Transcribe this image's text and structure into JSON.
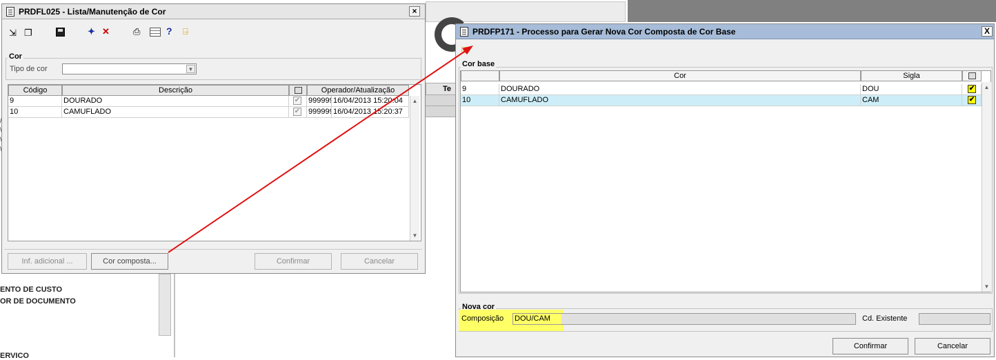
{
  "background": {
    "right_column_header": "Te",
    "left_list": [
      "ENTO DE CUSTO",
      "OR DE DOCUMENTO",
      "ERVICO"
    ]
  },
  "win1": {
    "title": "PRDFL025 - Lista/Manutenção de Cor",
    "close_glyph": "×",
    "group_label": "Cor",
    "tipo_label": "Tipo de cor",
    "tipo_value": "",
    "columns": [
      "Código",
      "Descrição",
      "",
      "Operador/Atualização"
    ],
    "rows": [
      {
        "codigo": "9",
        "descricao": "DOURADO",
        "operador": "999999",
        "data": "16/04/2013 15:20:04"
      },
      {
        "codigo": "10",
        "descricao": "CAMUFLADO",
        "operador": "999999",
        "data": "16/04/2013 15:20:37"
      }
    ],
    "buttons": {
      "inf": "Inf. adicional ...",
      "cor_composta": "Cor composta...",
      "confirmar": "Confirmar",
      "cancelar": "Cancelar"
    },
    "toolbar_icons": [
      "exit-icon",
      "copy-icon",
      "save-icon",
      "add-icon",
      "delete-icon",
      "print-icon",
      "grid-icon",
      "help-icon",
      "door-icon"
    ]
  },
  "win2": {
    "title": "PRDFP171 - Processo para Gerar Nova Cor Composta de Cor Base",
    "close_glyph": "X",
    "cor_base_label": "Cor base",
    "columns": [
      "",
      "Cor",
      "Sigla",
      ""
    ],
    "rows": [
      {
        "codigo": "9",
        "cor": "DOURADO",
        "sigla": "DOU",
        "checked": "✔"
      },
      {
        "codigo": "10",
        "cor": "CAMUFLADO",
        "sigla": "CAM",
        "checked": "✔"
      }
    ],
    "nova_cor_label": "Nova cor",
    "composicao_label": "Composição",
    "composicao_value": "DOU/CAM",
    "cd_existente_label": "Cd. Existente",
    "cd_existente_value": "",
    "buttons": {
      "confirmar": "Confirmar",
      "cancelar": "Cancelar"
    }
  },
  "colors": {
    "highlight_yellow": "#ffff66",
    "selected_row": "#cdeef8",
    "arrow_red": "#e01010",
    "title_blue": "#a6bcd8"
  }
}
